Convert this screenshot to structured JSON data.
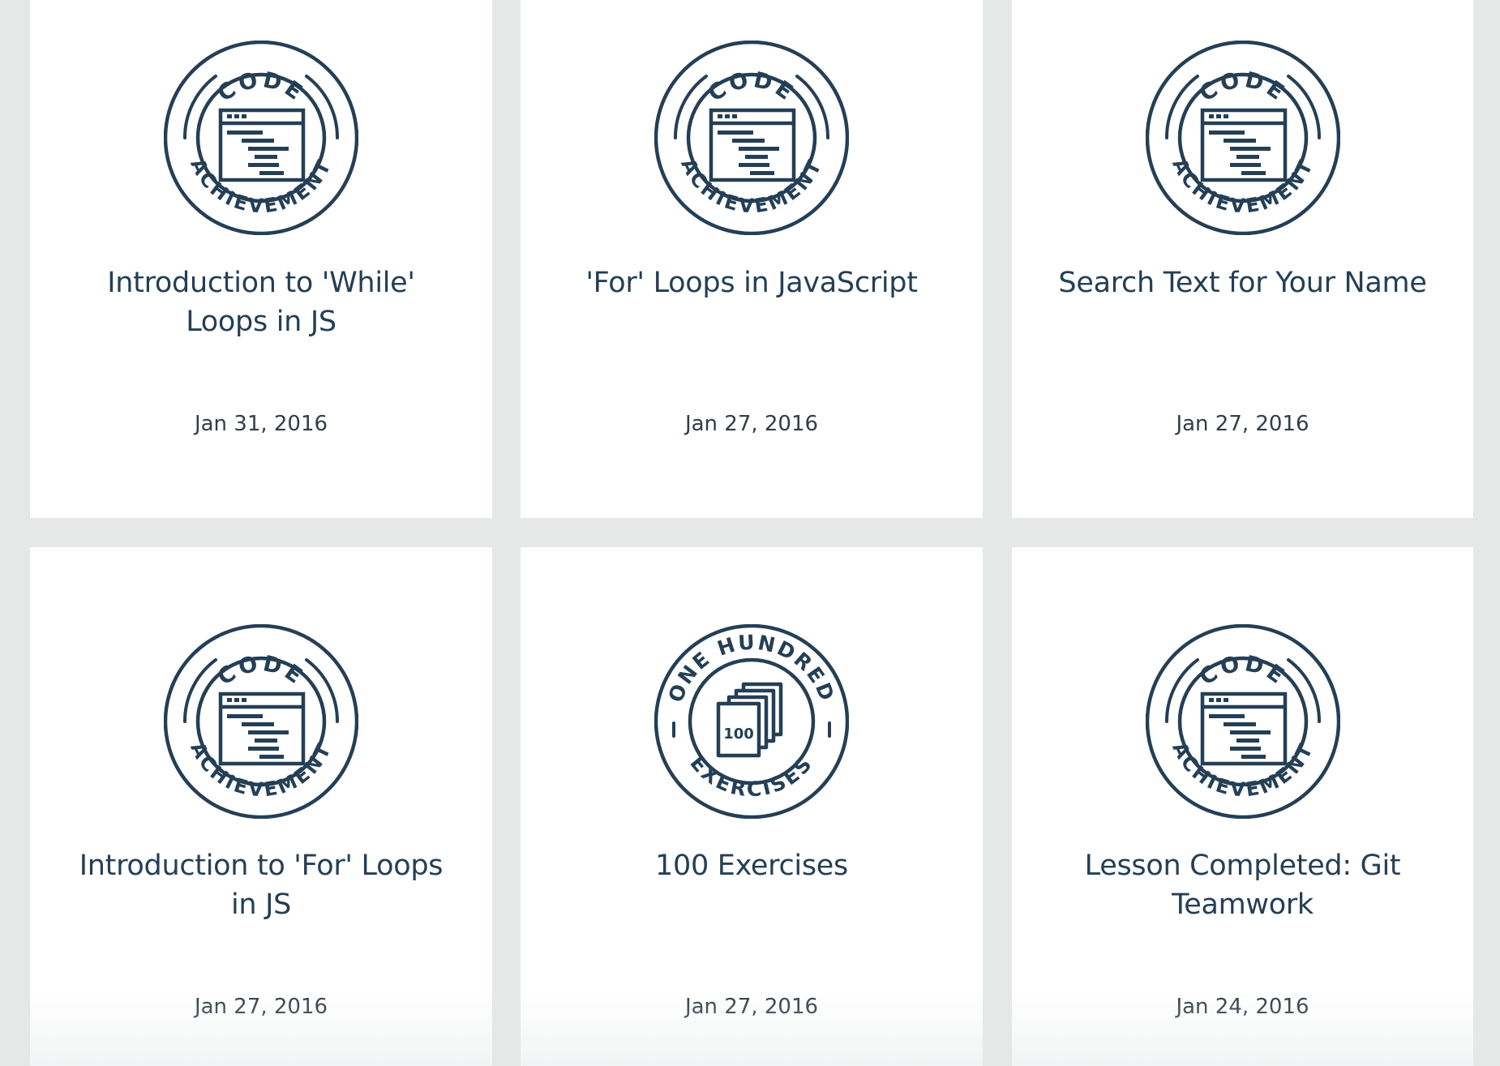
{
  "palette": {
    "page_background": "#e5e8e7",
    "card_background": "#ffffff",
    "badge_color": "#243f56",
    "title_color": "#243f56",
    "date_color": "#333d47"
  },
  "cards": [
    {
      "badge_icon": "code-achievement-badge-icon",
      "badge_top_text": "CODE",
      "badge_bottom_text": "ACHIEVEMENT",
      "title": "Introduction to 'While' Loops in JS",
      "date": "Jan 31, 2016"
    },
    {
      "badge_icon": "code-achievement-badge-icon",
      "badge_top_text": "CODE",
      "badge_bottom_text": "ACHIEVEMENT",
      "title": "'For' Loops in JavaScript",
      "date": "Jan 27, 2016"
    },
    {
      "badge_icon": "code-achievement-badge-icon",
      "badge_top_text": "CODE",
      "badge_bottom_text": "ACHIEVEMENT",
      "title": "Search Text for Your Name",
      "date": "Jan 27, 2016"
    },
    {
      "badge_icon": "code-achievement-badge-icon",
      "badge_top_text": "CODE",
      "badge_bottom_text": "ACHIEVEMENT",
      "title": "Introduction to 'For' Loops in JS",
      "date": "Jan 27, 2016"
    },
    {
      "badge_icon": "one-hundred-exercises-badge-icon",
      "badge_top_text": "ONE HUNDRED",
      "badge_bottom_text": "EXERCISES",
      "badge_center_text": "100",
      "title": "100 Exercises",
      "date": "Jan 27, 2016"
    },
    {
      "badge_icon": "code-achievement-badge-icon",
      "badge_top_text": "CODE",
      "badge_bottom_text": "ACHIEVEMENT",
      "title": "Lesson Completed: Git Teamwork",
      "date": "Jan 24, 2016"
    }
  ]
}
